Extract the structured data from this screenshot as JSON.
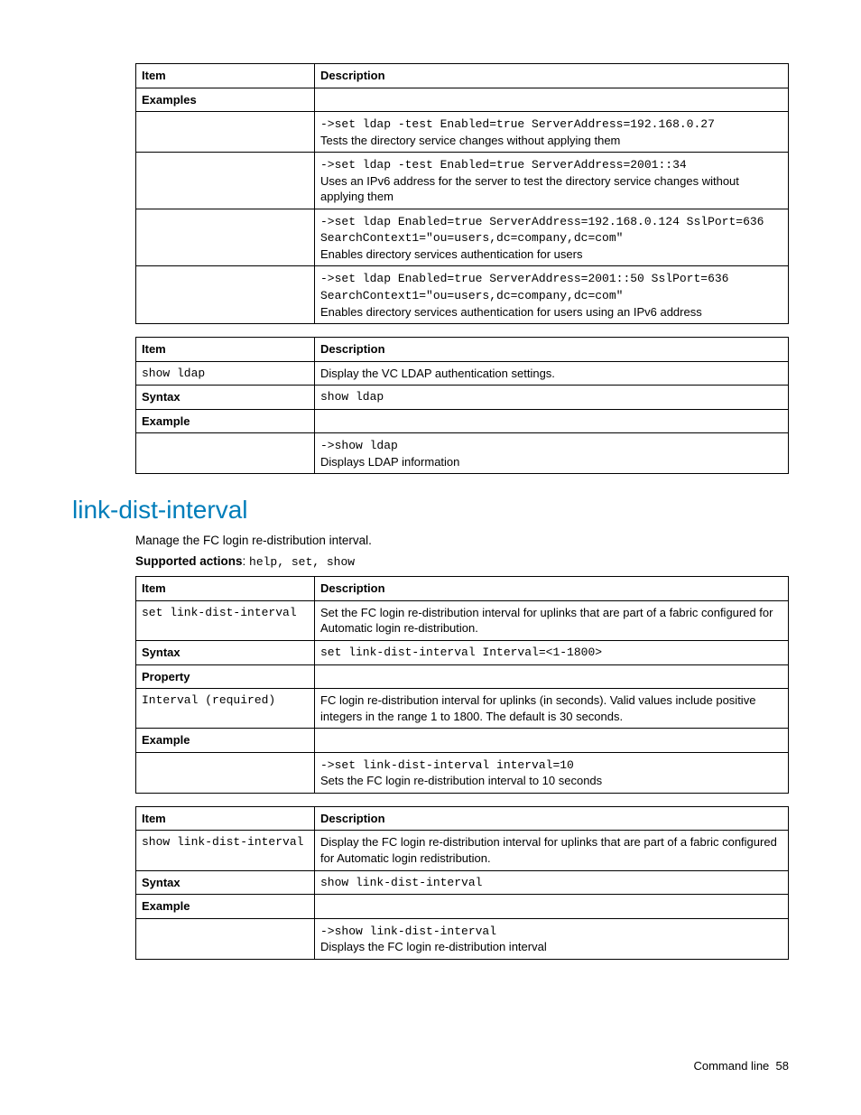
{
  "table1": {
    "h_item": "Item",
    "h_desc": "Description",
    "examples_label": "Examples",
    "r1_code": "->set ldap -test Enabled=true ServerAddress=192.168.0.27",
    "r1_text": "Tests the directory service changes without applying them",
    "r2_code": "->set ldap -test Enabled=true ServerAddress=2001::34",
    "r2_text": "Uses an IPv6 address for the server to test the directory service changes without applying them",
    "r3_code": "->set ldap Enabled=true ServerAddress=192.168.0.124 SslPort=636 SearchContext1=\"ou=users,dc=company,dc=com\"",
    "r3_text": "Enables directory services authentication for users",
    "r4_code": "->set ldap Enabled=true ServerAddress=2001::50 SslPort=636 SearchContext1=\"ou=users,dc=company,dc=com\"",
    "r4_text": "Enables directory services authentication for users using an IPv6 address"
  },
  "table2": {
    "h_item": "Item",
    "h_desc": "Description",
    "r1_code": "show ldap",
    "r1_text": "Display the VC LDAP authentication settings.",
    "syntax_label": "Syntax",
    "syntax_code": "show ldap",
    "example_label": "Example",
    "ex_code": "->show ldap",
    "ex_text": "Displays LDAP information"
  },
  "section": {
    "title": "link-dist-interval",
    "intro": "Manage the FC login re-distribution interval.",
    "sa_label": "Supported actions",
    "sa_colon": ": ",
    "sa_code": "help, set, show"
  },
  "table3": {
    "h_item": "Item",
    "h_desc": "Description",
    "r1_code": "set link-dist-interval",
    "r1_text": "Set the FC login re-distribution interval for uplinks that are part of a fabric configured for Automatic login re-distribution.",
    "syntax_label": "Syntax",
    "syntax_code": "set link-dist-interval Interval=<1-1800>",
    "property_label": "Property",
    "prop_code": "Interval (required)",
    "prop_text": "FC login re-distribution interval for uplinks (in seconds). Valid values include positive integers in the range 1 to 1800. The default is 30 seconds.",
    "example_label": "Example",
    "ex_code": "->set link-dist-interval interval=10",
    "ex_text": "Sets the FC login re-distribution interval to 10 seconds"
  },
  "table4": {
    "h_item": "Item",
    "h_desc": "Description",
    "r1_code": "show link-dist-interval",
    "r1_text": "Display the FC login re-distribution interval for uplinks that are part of a fabric configured for Automatic login redistribution.",
    "syntax_label": "Syntax",
    "syntax_code": "show link-dist-interval",
    "example_label": "Example",
    "ex_code": "->show link-dist-interval",
    "ex_text": "Displays the FC login re-distribution interval"
  },
  "footer": {
    "text": "Command line",
    "page": "58"
  }
}
